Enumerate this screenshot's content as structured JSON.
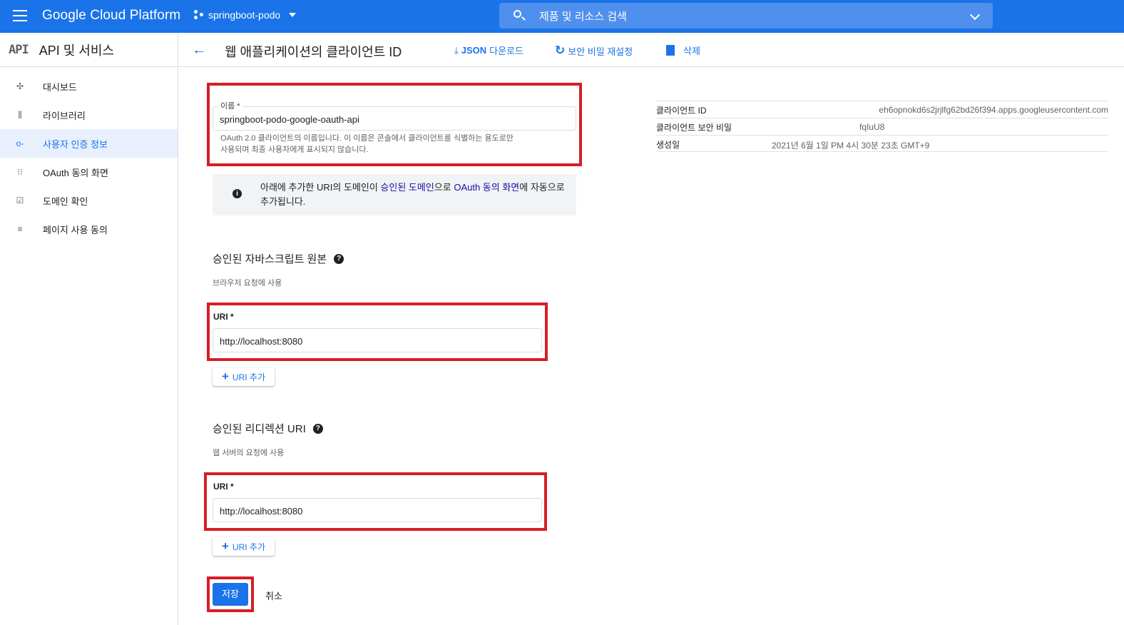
{
  "topbar": {
    "brand": "Google Cloud Platform",
    "project": "springboot-podo",
    "search_placeholder": "제품 및 리소스 검색"
  },
  "sidebar": {
    "logo": "API",
    "title": "API 및 서비스",
    "items": [
      {
        "label": "대시보드",
        "icon": "dashboard-icon",
        "active": false
      },
      {
        "label": "라이브러리",
        "icon": "library-icon",
        "active": false
      },
      {
        "label": "사용자 인증 정보",
        "icon": "key-icon",
        "active": true
      },
      {
        "label": "OAuth 동의 화면",
        "icon": "consent-icon",
        "active": false
      },
      {
        "label": "도메인 확인",
        "icon": "checkbox-icon",
        "active": false
      },
      {
        "label": "페이지 사용 동의",
        "icon": "settings-list-icon",
        "active": false
      }
    ]
  },
  "header": {
    "title": "웹 애플리케이션의 클라이언트 ID",
    "download_bold": "JSON",
    "download_label": "다운로드",
    "reset_label": "보안 비밀 재설정",
    "delete_label": "삭제"
  },
  "form": {
    "name_label": "이름 *",
    "name_value": "springboot-podo-google-oauth-api",
    "name_hint_1": "OAuth 2.0 클라이언트의 이름입니다. 이 이름은 콘솔에서 클라이언트를 식별하는 용도로만",
    "name_hint_2": "사용되며 최종 사용자에게 표시되지 않습니다.",
    "info_pre": "아래에 추가한 URI의 도메인이 ",
    "info_link1": "승인된 도메인",
    "info_mid": "으로 ",
    "info_link2": "OAuth 동의 화면",
    "info_post": "에 자동으로 추가됩니다.",
    "js_title": "승인된 자바스크립트 원본",
    "js_hint": "브라우저 요청에 사용",
    "js_uri_label": "URI *",
    "js_uri_value": "http://localhost:8080",
    "add_uri_label": "URI 추가",
    "redirect_title": "승인된 리디렉션 URI",
    "redirect_hint": "웹 서버의 요청에 사용",
    "redirect_uri_label": "URI *",
    "redirect_uri_value": "http://localhost:8080",
    "save_label": "저장",
    "cancel_label": "취소"
  },
  "meta": {
    "client_id_label": "클라이언트 ID",
    "client_id_value": "eh6opnokd6s2jrjlfg62bd26f394.apps.googleusercontent.com",
    "secret_label": "클라이언트 보안 비밀",
    "secret_value": "fqIuU8",
    "created_label": "생성일",
    "created_value": "2021년 6월 1일 PM 4시 30분 23초 GMT+9"
  },
  "colors": {
    "primary": "#1a73e8",
    "highlight": "#d61e26"
  }
}
